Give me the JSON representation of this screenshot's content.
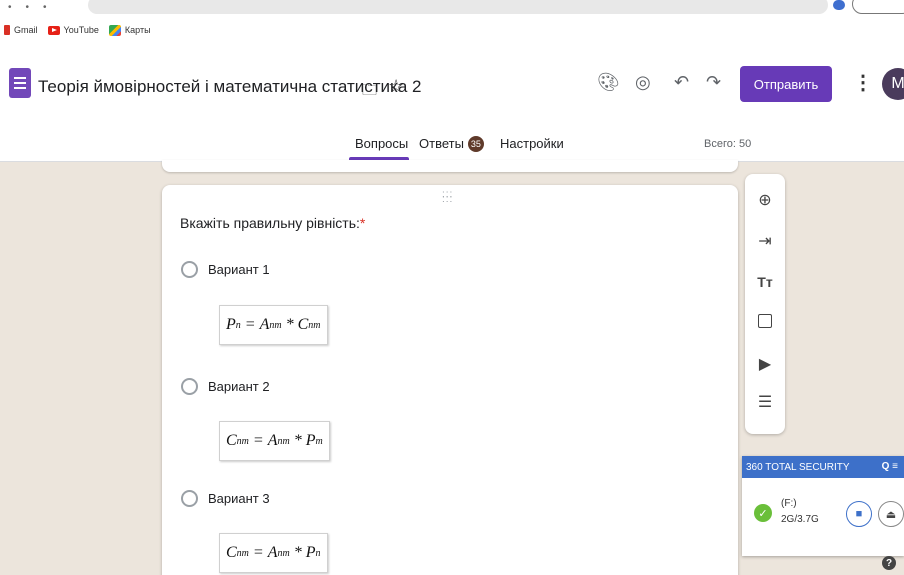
{
  "bookmarks": [
    {
      "label": "Gmail",
      "icon": "gmail-icon"
    },
    {
      "label": "YouTube",
      "icon": "youtube-icon"
    },
    {
      "label": "Карты",
      "icon": "maps-icon"
    }
  ],
  "header": {
    "title": "Теорія ймовірностей і математична статистика 2",
    "send_label": "Отправить",
    "avatar_letter": "M",
    "accent_color": "#673ab7"
  },
  "tabs": {
    "questions": "Вопросы",
    "answers": "Ответы",
    "answers_count": "35",
    "settings": "Настройки",
    "total": "Всего: 50"
  },
  "question": {
    "title": "Вкажіть правильну рівність:",
    "required_mark": "*",
    "options": [
      {
        "label": "Вариант 1"
      },
      {
        "label": "Вариант 2"
      },
      {
        "label": "Вариант 3"
      }
    ]
  },
  "toolbar": {
    "icons": [
      "add-question-icon",
      "import-questions-icon",
      "add-title-icon",
      "add-image-icon",
      "add-video-icon",
      "add-section-icon"
    ]
  },
  "security_popup": {
    "title": "360 TOTAL SECURITY",
    "drive": "(F:)",
    "size": "2G/3.7G"
  }
}
